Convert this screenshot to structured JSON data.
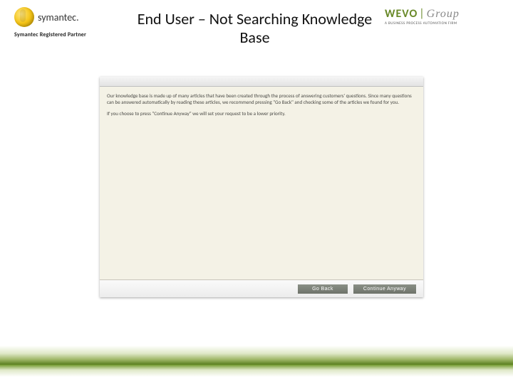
{
  "header": {
    "left_logo": {
      "brand": "symantec.",
      "tagline": "Symantec Registered Partner"
    },
    "title": "End User – Not Searching Knowledge Base",
    "right_logo": {
      "brand_part1": "WEVO",
      "brand_divider": "|",
      "brand_part2": "Group",
      "tagline": "A BUSINESS PROCESS AUTOMATION FIRM"
    }
  },
  "panel": {
    "paragraph1": "Our knowledge base is made up of many articles that have been created through the process of answering customers' questions. Since many questions can be answered automatically by reading these articles, we recommend pressing \"Go Back\" and checking some of the articles we found for you.",
    "paragraph2": "If you choose to press \"Continue Anyway\" we will set your request to be a lower priority.",
    "buttons": {
      "back": "Go Back",
      "continue": "Continue Anyway"
    }
  }
}
